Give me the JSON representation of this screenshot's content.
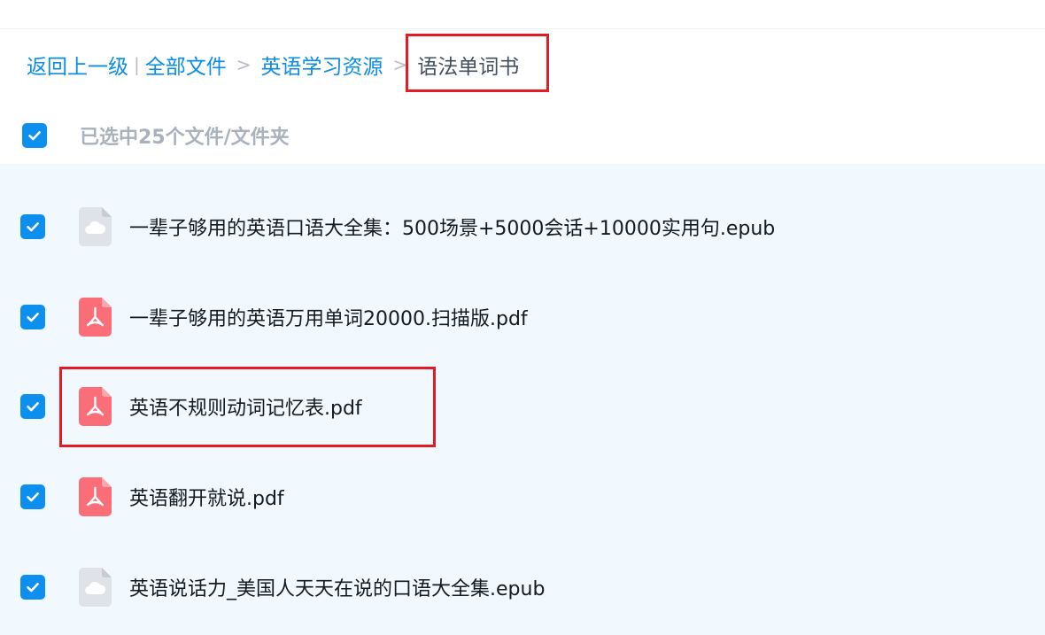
{
  "breadcrumb": {
    "back": "返回上一级",
    "pipe": "|",
    "all_files": "全部文件",
    "sep": ">",
    "parent_folder": "英语学习资源",
    "current_folder": "语法单词书"
  },
  "selection": {
    "summary": "已选中25个文件/文件夹",
    "checked": true
  },
  "files": [
    {
      "name": "一辈子够用的英语口语大全集：500场景+5000会话+10000实用句.epub",
      "icon": "cloud-file-icon",
      "checked": true
    },
    {
      "name": "一辈子够用的英语万用单词20000.扫描版.pdf",
      "icon": "pdf-icon",
      "checked": true
    },
    {
      "name": "英语不规则动词记忆表.pdf",
      "icon": "pdf-icon",
      "checked": true
    },
    {
      "name": "英语翻开就说.pdf",
      "icon": "pdf-icon",
      "checked": true
    },
    {
      "name": "英语说话力_美国人天天在说的口语大全集.epub",
      "icon": "cloud-file-icon",
      "checked": true
    }
  ],
  "colors": {
    "accent": "#0d8ff0",
    "link": "#0a8ce8",
    "highlight": "#e31b23",
    "pdf": "#fb6e77",
    "list_bg": "#f1f8fe"
  }
}
